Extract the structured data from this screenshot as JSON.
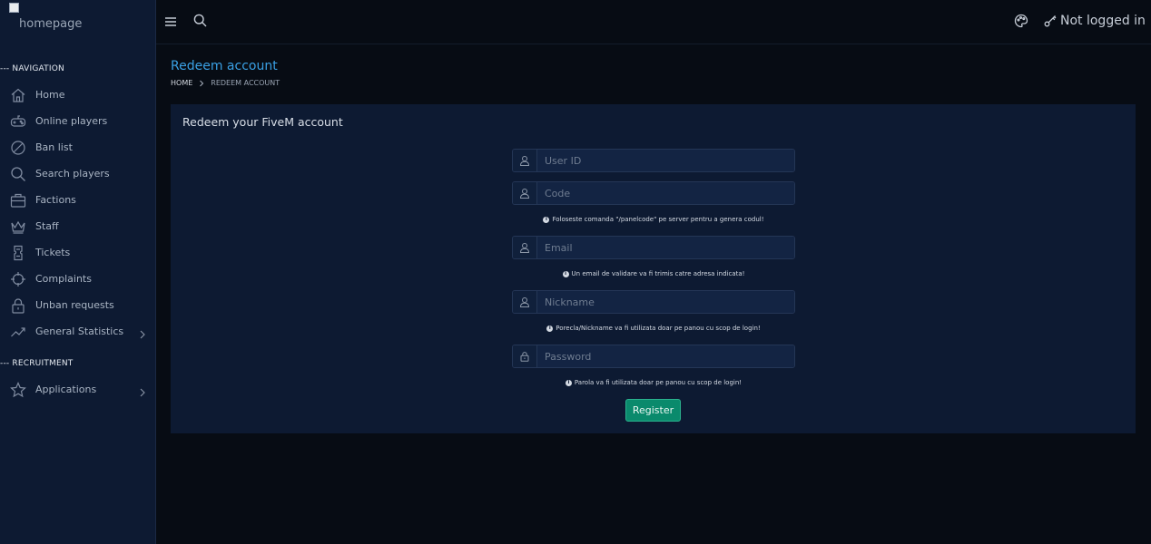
{
  "logo": {
    "alt_text": "homepage"
  },
  "sidebar": {
    "section_navigation": "--- NAVIGATION",
    "section_recruitment": "--- RECRUITMENT",
    "items": [
      {
        "label": "Home",
        "icon": "home-icon"
      },
      {
        "label": "Online players",
        "icon": "gamepad-icon"
      },
      {
        "label": "Ban list",
        "icon": "ban-icon"
      },
      {
        "label": "Search players",
        "icon": "search-icon"
      },
      {
        "label": "Factions",
        "icon": "briefcase-icon"
      },
      {
        "label": "Staff",
        "icon": "crown-icon"
      },
      {
        "label": "Tickets",
        "icon": "ticket-icon"
      },
      {
        "label": "Complaints",
        "icon": "crosshair-icon"
      },
      {
        "label": "Unban requests",
        "icon": "lock-icon"
      },
      {
        "label": "General Statistics",
        "icon": "chart-line-icon"
      }
    ],
    "recruitment_items": [
      {
        "label": "Applications",
        "icon": "star-icon"
      }
    ]
  },
  "topbar": {
    "login_text": "Not logged in"
  },
  "page": {
    "title": "Redeem account",
    "breadcrumb": [
      "HOME",
      "REDEEM ACCOUNT"
    ]
  },
  "form": {
    "card_title": "Redeem your FiveM account",
    "user_id_placeholder": "User ID",
    "code_placeholder": "Code",
    "code_hint": "Foloseste comanda \"/panelcode\" pe server pentru a genera codul!",
    "email_placeholder": "Email",
    "email_hint": "Un email de validare va fi trimis catre adresa indicata!",
    "nickname_placeholder": "Nickname",
    "nickname_hint": "Porecla/Nickname va fi utilizata doar pe panou cu scop de login!",
    "password_placeholder": "Password",
    "password_hint": "Parola va fi utilizata doar pe panou cu scop de login!",
    "register_label": "Register"
  },
  "colors": {
    "background": "#070c14",
    "sidebar": "#0d1a32",
    "accent_title": "#3aa0e4",
    "register_button": "#0a8a6c"
  }
}
